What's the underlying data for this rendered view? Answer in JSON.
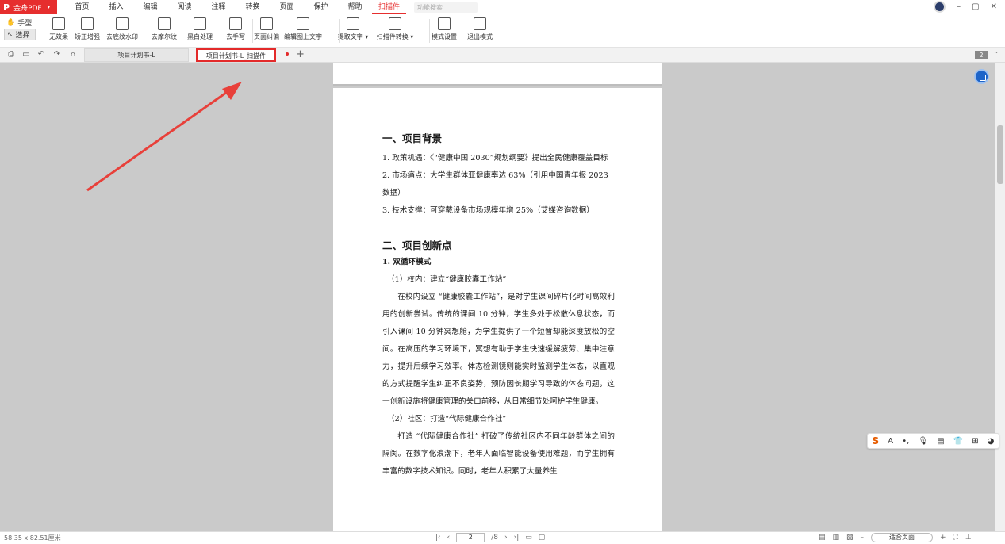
{
  "app": {
    "logo": "P",
    "name": "金舟PDF",
    "caret": "▾"
  },
  "menu": {
    "items": [
      "首页",
      "插入",
      "编辑",
      "阅读",
      "注释",
      "转换",
      "页面",
      "保护",
      "帮助",
      "扫描件"
    ],
    "active_index": 9,
    "search_placeholder": "功能搜索"
  },
  "window": {
    "minimize": "–",
    "maximize": "▢",
    "close": "✕"
  },
  "modes": {
    "hand": "手型",
    "select": "选择"
  },
  "tools": [
    "无效果",
    "矫正增强",
    "去底纹水印",
    "去摩尔纹",
    "黑白处理",
    "去手写",
    "页面纠偏",
    "编辑图上文字",
    "提取文字",
    "扫描件转换",
    "模式设置",
    "退出模式"
  ],
  "tabs": {
    "tab1": "项目计划书-L",
    "tab2": "项目计划书-L_扫描件",
    "plus": "+"
  },
  "page_badge": "2",
  "document": {
    "section1_title": "一、项目背景",
    "s1_items": [
      "1. 政策机遇：《“健康中国 2030”规划纲要》提出全民健康覆盖目标",
      "2. 市场痛点：大学生群体亚健康率达 63%（引用中国青年报 2023 数据）",
      "3. 技术支撑：可穿戴设备市场规模年增 25%（艾媒咨询数据）"
    ],
    "section2_title": "二、项目创新点",
    "sub1_title": "1. 双循环模式",
    "campus_title": "（1）校内：建立“健康胶囊工作站”",
    "campus_para": "在校内设立 “健康胶囊工作站”，是对学生课间碎片化时间高效利用的创新尝试。传统的课间 10 分钟，学生多处于松散休息状态，而引入课间 10 分钟冥想舱，为学生提供了一个短暂却能深度放松的空间。在高压的学习环境下，冥想有助于学生快速缓解疲劳、集中注意力，提升后续学习效率。体态检测镜则能实时监测学生体态，以直观的方式提醒学生纠正不良姿势，预防因长期学习导致的体态问题，这一创新设施将健康管理的关口前移，从日常细节处呵护学生健康。",
    "community_title": "（2）社区：打造“代际健康合作社”",
    "community_para": "打造 “代际健康合作社” 打破了传统社区内不同年龄群体之间的隔阂。在数字化浪潮下，老年人面临智能设备使用难题，而学生拥有丰富的数字技术知识。同时，老年人积累了大量养生"
  },
  "status": {
    "page_size": "58.35 x 82.51厘米",
    "current_page": "2",
    "total_pages": "/8",
    "zoom_label": "适合页面"
  }
}
